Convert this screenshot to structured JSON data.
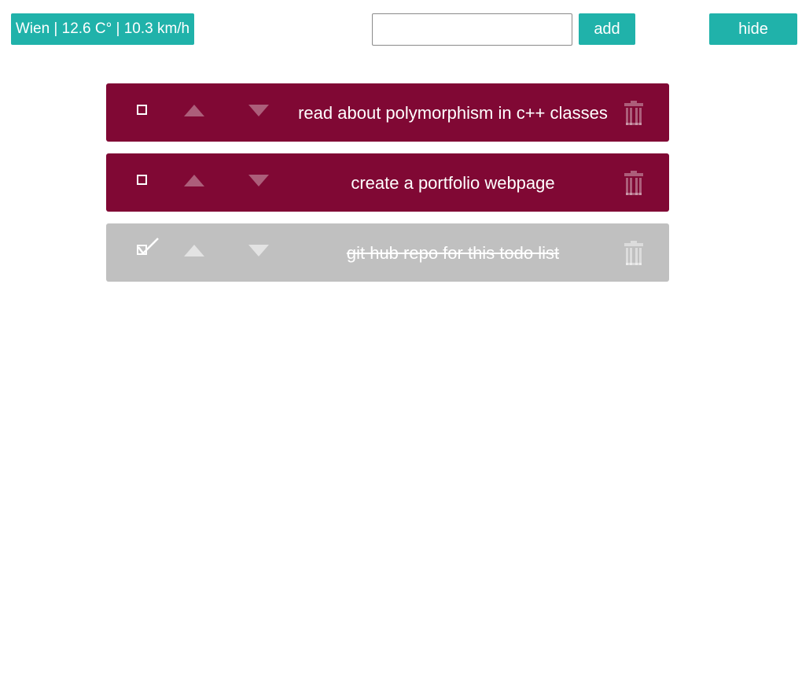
{
  "header": {
    "weather_text": "Wien | 12.6 C° | 10.3 km/h",
    "task_input": {
      "value": "",
      "placeholder": ""
    },
    "add_label": "add",
    "hide_label": "hide"
  },
  "colors": {
    "accent": "#20b2aa",
    "todo_active": "#800834",
    "todo_done": "#c0c0c0"
  },
  "todos": [
    {
      "text": "read about polymorphism in c++ classes",
      "done": false
    },
    {
      "text": "create a portfolio webpage",
      "done": false
    },
    {
      "text": "git hub repo for this todo list",
      "done": true
    }
  ],
  "icons": {
    "checkbox": "checkbox-icon",
    "move_up": "arrow-up-icon",
    "move_down": "arrow-down-icon",
    "delete": "trash-icon"
  }
}
